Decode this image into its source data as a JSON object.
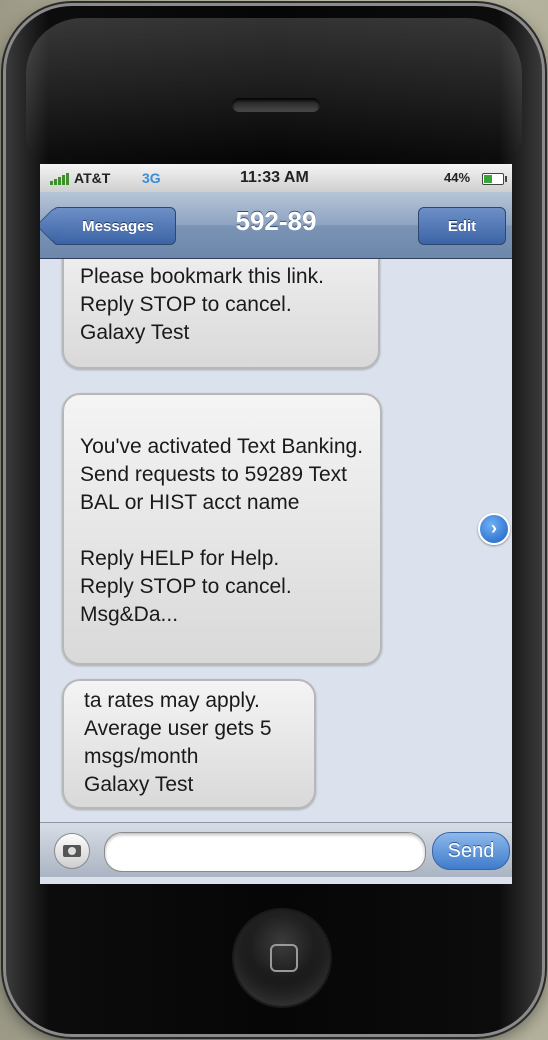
{
  "status_bar": {
    "carrier": "AT&T",
    "network": "3G",
    "time": "11:33 AM",
    "battery_percent": "44%",
    "battery_level": 0.44,
    "signal_bars": 5
  },
  "nav": {
    "back_label": "Messages",
    "title": "592-89",
    "edit_label": "Edit"
  },
  "messages": [
    {
      "text": "Please bookmark this link.\nReply STOP to cancel.\nGalaxy Test"
    },
    {
      "text": "You've activated Text Banking. Send requests to 59289 Text BAL or HIST acct name\n\nReply HELP for Help.\nReply STOP to cancel.\nMsg&Da..."
    },
    {
      "text": "ta rates may apply.\nAverage user gets 5 msgs/month\nGalaxy Test"
    }
  ],
  "more_icon": "chevron-right-icon",
  "compose": {
    "value": "",
    "placeholder": "",
    "send_label": "Send"
  },
  "colors": {
    "accent": "#3c64a6",
    "network": "#3e8bd6"
  }
}
